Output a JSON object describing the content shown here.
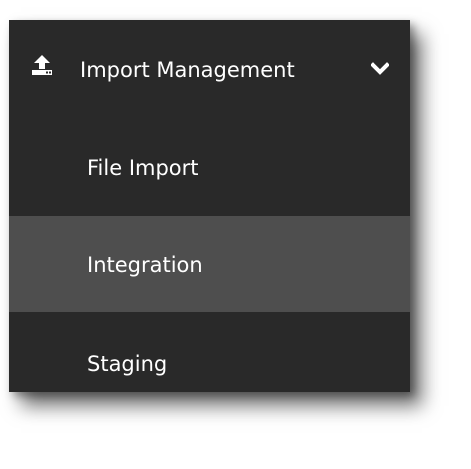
{
  "menu": {
    "header": {
      "label": "Import Management",
      "icon": "upload-icon",
      "toggle_icon": "chevron-down-icon",
      "expanded": true
    },
    "items": [
      {
        "label": "File Import",
        "active": false
      },
      {
        "label": "Integration",
        "active": true
      },
      {
        "label": "Staging",
        "active": false
      }
    ]
  },
  "colors": {
    "background": "#292929",
    "active_item": "#4e4e4e",
    "text": "#ffffff"
  }
}
